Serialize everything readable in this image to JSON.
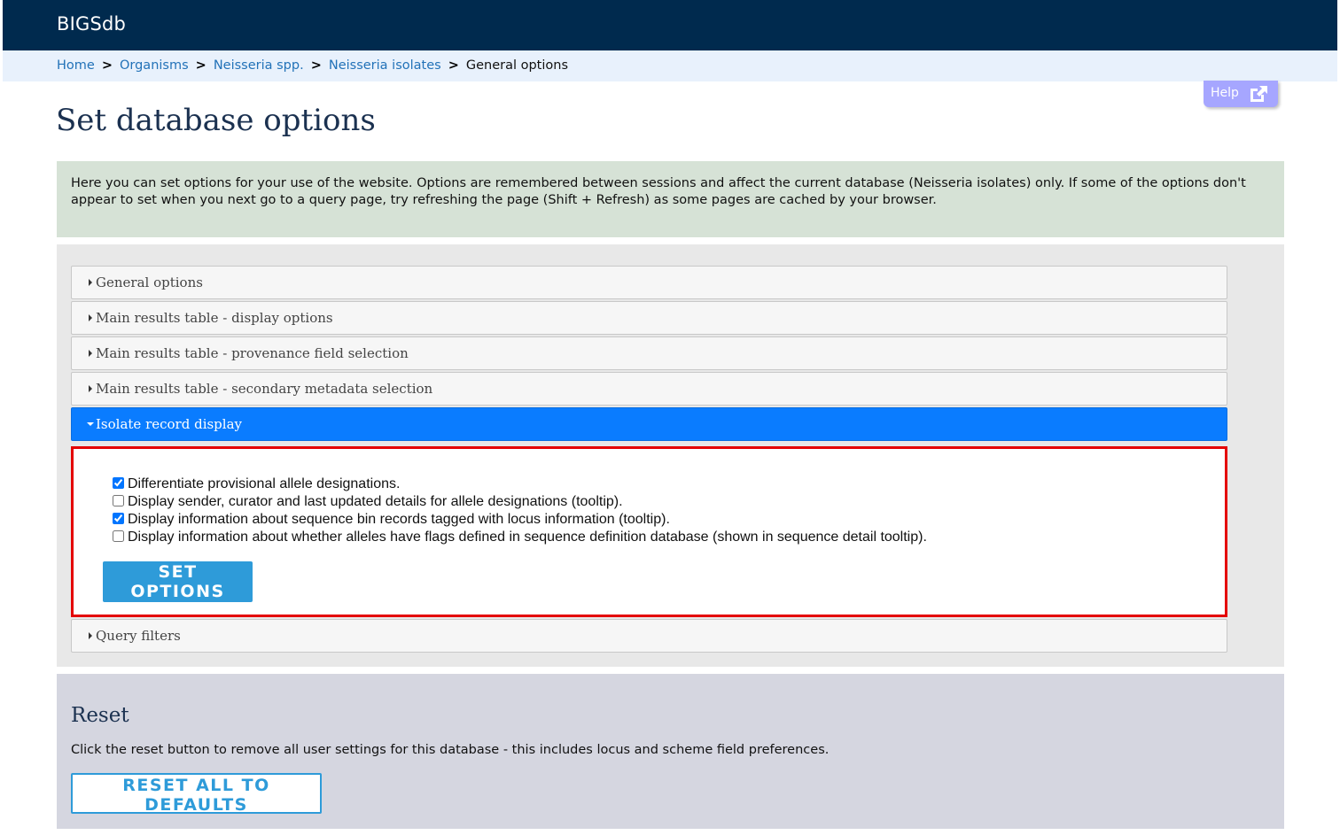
{
  "app": {
    "brand": "BIGSdb"
  },
  "breadcrumb": {
    "items": [
      "Home",
      "Organisms",
      "Neisseria spp.",
      "Neisseria isolates"
    ],
    "separator": ">",
    "current": "General options"
  },
  "help": {
    "label": "Help",
    "icon": "external-link-icon"
  },
  "page": {
    "title": "Set database options"
  },
  "intro": {
    "text": "Here you can set options for your use of the website. Options are remembered between sessions and affect the current database (Neisseria isolates) only. If some of the options don't appear to set when you next go to a query page, try refreshing the page (Shift + Refresh) as some pages are cached by your browser."
  },
  "accordion": {
    "sections": [
      {
        "label": "General options",
        "expanded": false
      },
      {
        "label": "Main results table - display options",
        "expanded": false
      },
      {
        "label": "Main results table - provenance field selection",
        "expanded": false
      },
      {
        "label": "Main results table - secondary metadata selection",
        "expanded": false
      },
      {
        "label": "Isolate record display",
        "expanded": true
      },
      {
        "label": "Query filters",
        "expanded": false
      }
    ]
  },
  "isolate_display": {
    "options": [
      {
        "label": "Differentiate provisional allele designations.",
        "checked": true
      },
      {
        "label": "Display sender, curator and last updated details for allele designations (tooltip).",
        "checked": false
      },
      {
        "label": "Display information about sequence bin records tagged with locus information (tooltip).",
        "checked": true
      },
      {
        "label": "Display information about whether alleles have flags defined in sequence definition database (shown in sequence detail tooltip).",
        "checked": false
      }
    ],
    "submit_label": "SET OPTIONS"
  },
  "reset": {
    "heading": "Reset",
    "text": "Click the reset button to remove all user settings for this database - this includes locus and scheme field preferences.",
    "button_label": "RESET ALL TO DEFAULTS"
  },
  "colors": {
    "header_bg": "#002a4e",
    "breadcrumb_bg": "#e8f1fc",
    "link": "#2272b8",
    "active_section": "#0a7cff",
    "highlight_border": "#e40000",
    "button_primary": "#2e9bd9",
    "help_bg": "#a6a6ff"
  }
}
